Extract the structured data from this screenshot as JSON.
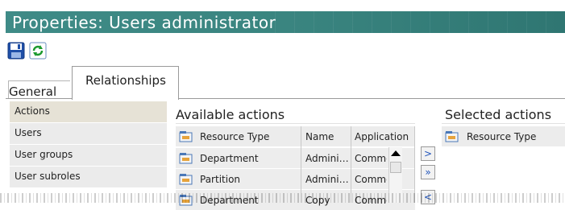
{
  "window": {
    "title": "Properties: Users administrator"
  },
  "toolbar": {
    "icons": [
      "save-icon",
      "refresh-icon"
    ]
  },
  "tabs": [
    {
      "label": "General",
      "active": false
    },
    {
      "label": "Relationships",
      "active": true
    }
  ],
  "left_list": [
    {
      "label": "Actions",
      "selected": true
    },
    {
      "label": "Users",
      "selected": false
    },
    {
      "label": "User groups",
      "selected": false
    },
    {
      "label": "User subroles",
      "selected": false
    }
  ],
  "available": {
    "title": "Available actions",
    "columns": [
      "Resource Type",
      "Name",
      "Application"
    ],
    "rows": [
      {
        "resource_type": "Department",
        "name": "Admini…",
        "application": "Commor"
      },
      {
        "resource_type": "Partition",
        "name": "Admini…",
        "application": "Commor"
      },
      {
        "resource_type": "Department",
        "name": "Copy",
        "application": "Commor"
      }
    ]
  },
  "transfer": {
    "add": ">",
    "add_all": "»",
    "remove": "<"
  },
  "selected": {
    "title": "Selected actions",
    "columns": [
      "Resource Type"
    ]
  },
  "colors": {
    "title_bar": "#3f8a86",
    "list_bg": "#ebebeb",
    "selected_row": "#e6e2d6"
  }
}
